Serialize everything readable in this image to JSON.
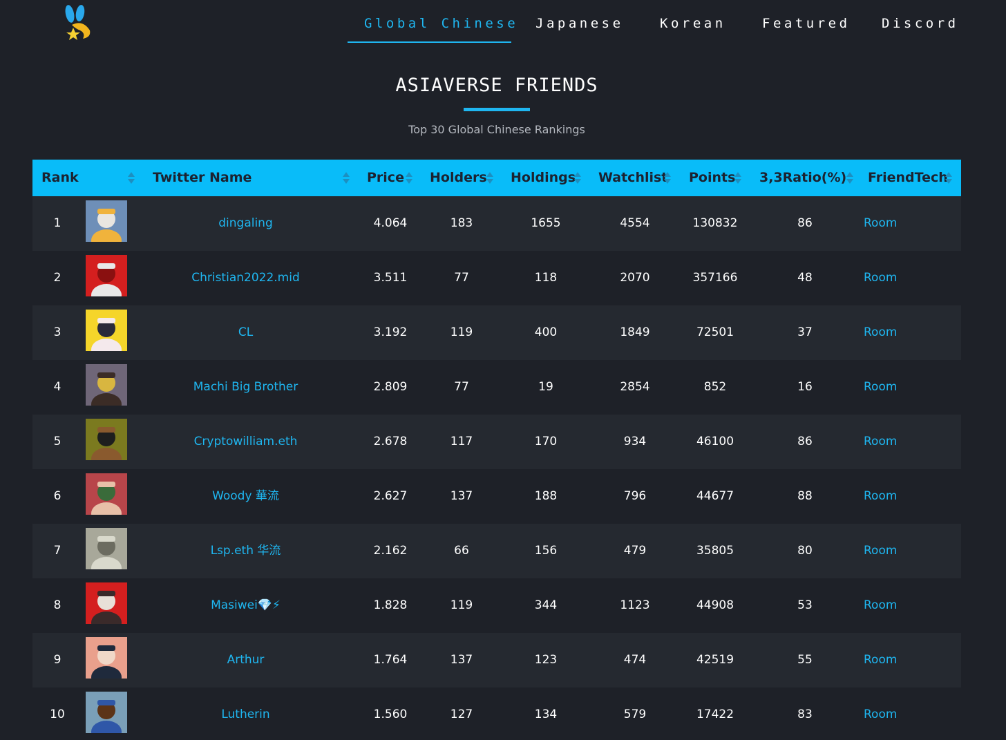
{
  "nav": {
    "items": [
      {
        "label": "Global Chinese",
        "active": true
      },
      {
        "label": "Japanese",
        "active": false
      },
      {
        "label": "Korean",
        "active": false
      },
      {
        "label": "Featured",
        "active": false
      },
      {
        "label": "Discord",
        "active": false
      }
    ]
  },
  "header": {
    "title": "ASIAVERSE FRIENDS",
    "subtitle": "Top 30 Global Chinese Rankings"
  },
  "table": {
    "columns": [
      "Rank",
      "Twitter Name",
      "Price",
      "Holders",
      "Holdings",
      "Watchlist",
      "Points",
      "3,3Ratio(%)",
      "FriendTech"
    ],
    "rows": [
      {
        "rank": "1",
        "name": "dingaling",
        "price": "4.064",
        "holders": "183",
        "holdings": "1655",
        "watchlist": "4554",
        "points": "130832",
        "ratio": "86",
        "friendtech": "Room",
        "avatar_colors": [
          "#6e8fb8",
          "#f0b33c",
          "#e9e6e0"
        ]
      },
      {
        "rank": "2",
        "name": "Christian2022.mid",
        "price": "3.511",
        "holders": "77",
        "holdings": "118",
        "watchlist": "2070",
        "points": "357166",
        "ratio": "48",
        "friendtech": "Room",
        "avatar_colors": [
          "#d41f1f",
          "#e8e8e8",
          "#8a1010"
        ]
      },
      {
        "rank": "3",
        "name": "CL",
        "price": "3.192",
        "holders": "119",
        "holdings": "400",
        "watchlist": "1849",
        "points": "72501",
        "ratio": "37",
        "friendtech": "Room",
        "avatar_colors": [
          "#f5d52a",
          "#f4e9ec",
          "#2a2a3a"
        ]
      },
      {
        "rank": "4",
        "name": "Machi Big Brother",
        "price": "2.809",
        "holders": "77",
        "holdings": "19",
        "watchlist": "2854",
        "points": "852",
        "ratio": "16",
        "friendtech": "Room",
        "avatar_colors": [
          "#6f6678",
          "#3b2c26",
          "#d8b640"
        ]
      },
      {
        "rank": "5",
        "name": "Cryptowilliam.eth",
        "price": "2.678",
        "holders": "117",
        "holdings": "170",
        "watchlist": "934",
        "points": "46100",
        "ratio": "86",
        "friendtech": "Room",
        "avatar_colors": [
          "#7b7a1f",
          "#8a5a2e",
          "#1e1e1e"
        ]
      },
      {
        "rank": "6",
        "name": "Woody 華流",
        "price": "2.627",
        "holders": "137",
        "holdings": "188",
        "watchlist": "796",
        "points": "44677",
        "ratio": "88",
        "friendtech": "Room",
        "avatar_colors": [
          "#b8454a",
          "#e8c0a8",
          "#3a6b3a"
        ]
      },
      {
        "rank": "7",
        "name": "Lsp.eth 华流",
        "price": "2.162",
        "holders": "66",
        "holdings": "156",
        "watchlist": "479",
        "points": "35805",
        "ratio": "80",
        "friendtech": "Room",
        "avatar_colors": [
          "#a8a89a",
          "#d9d9cc",
          "#6c6c60"
        ]
      },
      {
        "rank": "8",
        "name": "Masiwei💎⚡",
        "price": "1.828",
        "holders": "119",
        "holdings": "344",
        "watchlist": "1123",
        "points": "44908",
        "ratio": "53",
        "friendtech": "Room",
        "avatar_colors": [
          "#d41f1f",
          "#3a2a2a",
          "#e8e0d8"
        ]
      },
      {
        "rank": "9",
        "name": "Arthur",
        "price": "1.764",
        "holders": "137",
        "holdings": "123",
        "watchlist": "474",
        "points": "42519",
        "ratio": "55",
        "friendtech": "Room",
        "avatar_colors": [
          "#e9a08c",
          "#1f2a3c",
          "#f0d8c8"
        ]
      },
      {
        "rank": "10",
        "name": "Lutherin",
        "price": "1.560",
        "holders": "127",
        "holdings": "134",
        "watchlist": "579",
        "points": "17422",
        "ratio": "83",
        "friendtech": "Room",
        "avatar_colors": [
          "#7a9fb8",
          "#2f57a8",
          "#5c3418"
        ]
      }
    ]
  },
  "colors": {
    "accent": "#1fb6f0",
    "header_bg": "#09bcf9",
    "page_bg": "#1e2128",
    "row_alt_bg": "#252930"
  }
}
